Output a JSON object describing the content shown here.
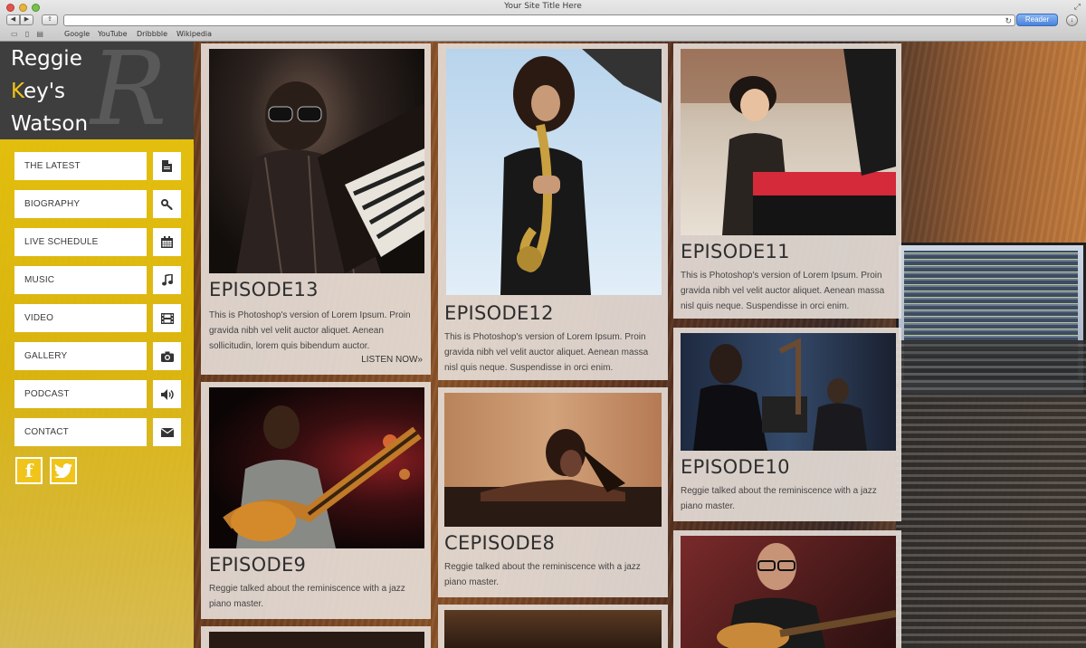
{
  "browser": {
    "window_title": "Your Site Title Here",
    "reader_label": "Reader",
    "bookmarks": [
      "Google",
      "YouTube",
      "Dribbble",
      "Wikipedia"
    ]
  },
  "site": {
    "name_line1": "Reggie",
    "name_line2_initial": "K",
    "name_line2_rest": "ey's",
    "name_line3": "Watson",
    "monogram": "R"
  },
  "menu": [
    {
      "label": "THE LATEST",
      "icon": "document-icon"
    },
    {
      "label": "BIOGRAPHY",
      "icon": "key-icon"
    },
    {
      "label": "LIVE SCHEDULE",
      "icon": "calendar-icon"
    },
    {
      "label": "MUSIC",
      "icon": "music-note-icon"
    },
    {
      "label": "VIDEO",
      "icon": "film-icon"
    },
    {
      "label": "GALLERY",
      "icon": "camera-icon"
    },
    {
      "label": "PODCAST",
      "icon": "speaker-icon"
    },
    {
      "label": "CONTACT",
      "icon": "envelope-icon"
    }
  ],
  "social": {
    "facebook": "f",
    "twitter": "🐦"
  },
  "episodes": {
    "ep13": {
      "title": "EPISODE13",
      "desc": "This is Photoshop's version of Lorem Ipsum. Proin gravida nibh vel velit auctor aliquet. Aenean sollicitudin, lorem quis bibendum auctor.",
      "link": "LISTEN NOW»"
    },
    "ep12": {
      "title": "EPISODE12",
      "desc": "This is Photoshop's version of Lorem Ipsum. Proin gravida nibh vel velit auctor aliquet. Aenean massa nisl quis neque. Suspendisse in orci enim."
    },
    "ep11": {
      "title": "EPISODE11",
      "desc": "This is Photoshop's version of Lorem Ipsum. Proin gravida nibh vel velit auctor aliquet. Aenean massa nisl quis neque. Suspendisse in orci enim."
    },
    "ep10": {
      "title": "EPISODE10",
      "desc": "Reggie talked about the reminiscence with a jazz piano master."
    },
    "ep9": {
      "title": "EPISODE9",
      "desc": "Reggie talked about the reminiscence with a jazz piano master."
    },
    "ep8": {
      "title": "CEPISODE8",
      "desc": "Reggie talked about the reminiscence with a jazz piano master."
    }
  }
}
